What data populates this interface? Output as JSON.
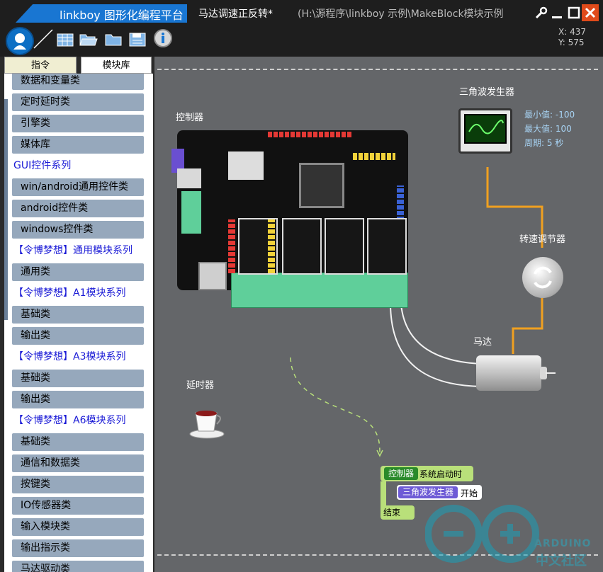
{
  "titlebar": {
    "app_name": "linkboy 图形化编程平台",
    "doc_title": "马达调速正反转*",
    "doc_path": "(H:\\源程序\\linkboy 示例\\MakeBlock模块示例"
  },
  "coords": {
    "x": "X: 437",
    "y": "Y: 575"
  },
  "tabs": [
    {
      "label": "指令"
    },
    {
      "label": "模块库"
    }
  ],
  "categories": [
    {
      "kind": "cat",
      "label": "数据和变量类"
    },
    {
      "kind": "cat",
      "label": "定时延时类"
    },
    {
      "kind": "cat",
      "label": "引擎类"
    },
    {
      "kind": "cat",
      "label": "媒体库"
    },
    {
      "kind": "group",
      "label": "GUI控件系列"
    },
    {
      "kind": "cat",
      "label": "win/android通用控件类"
    },
    {
      "kind": "cat",
      "label": "android控件类"
    },
    {
      "kind": "cat",
      "label": "windows控件类"
    },
    {
      "kind": "group",
      "label": "【令博梦想】通用模块系列"
    },
    {
      "kind": "cat",
      "label": "通用类"
    },
    {
      "kind": "group",
      "label": "【令博梦想】A1模块系列"
    },
    {
      "kind": "cat",
      "label": "基础类"
    },
    {
      "kind": "cat",
      "label": "输出类"
    },
    {
      "kind": "group",
      "label": "【令博梦想】A3模块系列"
    },
    {
      "kind": "cat",
      "label": "基础类"
    },
    {
      "kind": "cat",
      "label": "输出类"
    },
    {
      "kind": "group",
      "label": "【令博梦想】A6模块系列"
    },
    {
      "kind": "cat",
      "label": "基础类"
    },
    {
      "kind": "cat",
      "label": "通信和数据类"
    },
    {
      "kind": "cat",
      "label": "按键类"
    },
    {
      "kind": "cat",
      "label": "IO传感器类"
    },
    {
      "kind": "cat",
      "label": "输入模块类"
    },
    {
      "kind": "cat",
      "label": "输出指示类"
    },
    {
      "kind": "cat",
      "label": "马达驱动类"
    }
  ],
  "canvas": {
    "controller_label": "控制器",
    "triwave_label": "三角波发生器",
    "triwave_min": "最小值: -100",
    "triwave_max": "最大值: 100",
    "triwave_period": "周期: 5 秒",
    "speed_knob_label": "转速调节器",
    "motor_label": "马达",
    "delay_label": "延时器"
  },
  "blocks": {
    "start_tag": "控制器",
    "start_text": "系统启动时",
    "tri_tag": "三角波发生器",
    "tri_text": "开始",
    "end_text": "结束"
  },
  "watermark": {
    "line1": "ARDUINO",
    "line2": "中文社区"
  },
  "colors": {
    "canvas_bg": "#646669",
    "accent_blue": "#1976d2",
    "category_bg": "#96a8bc",
    "group_text": "#1a1ad6",
    "wire_orange": "#f0a020",
    "block_green": "#b9e07a"
  },
  "icons": [
    "app-logo-icon",
    "new-file-icon",
    "open-folder-icon",
    "folder-icon",
    "save-icon",
    "info-icon",
    "wrench-icon",
    "minimize-icon",
    "maximize-icon",
    "close-icon"
  ]
}
